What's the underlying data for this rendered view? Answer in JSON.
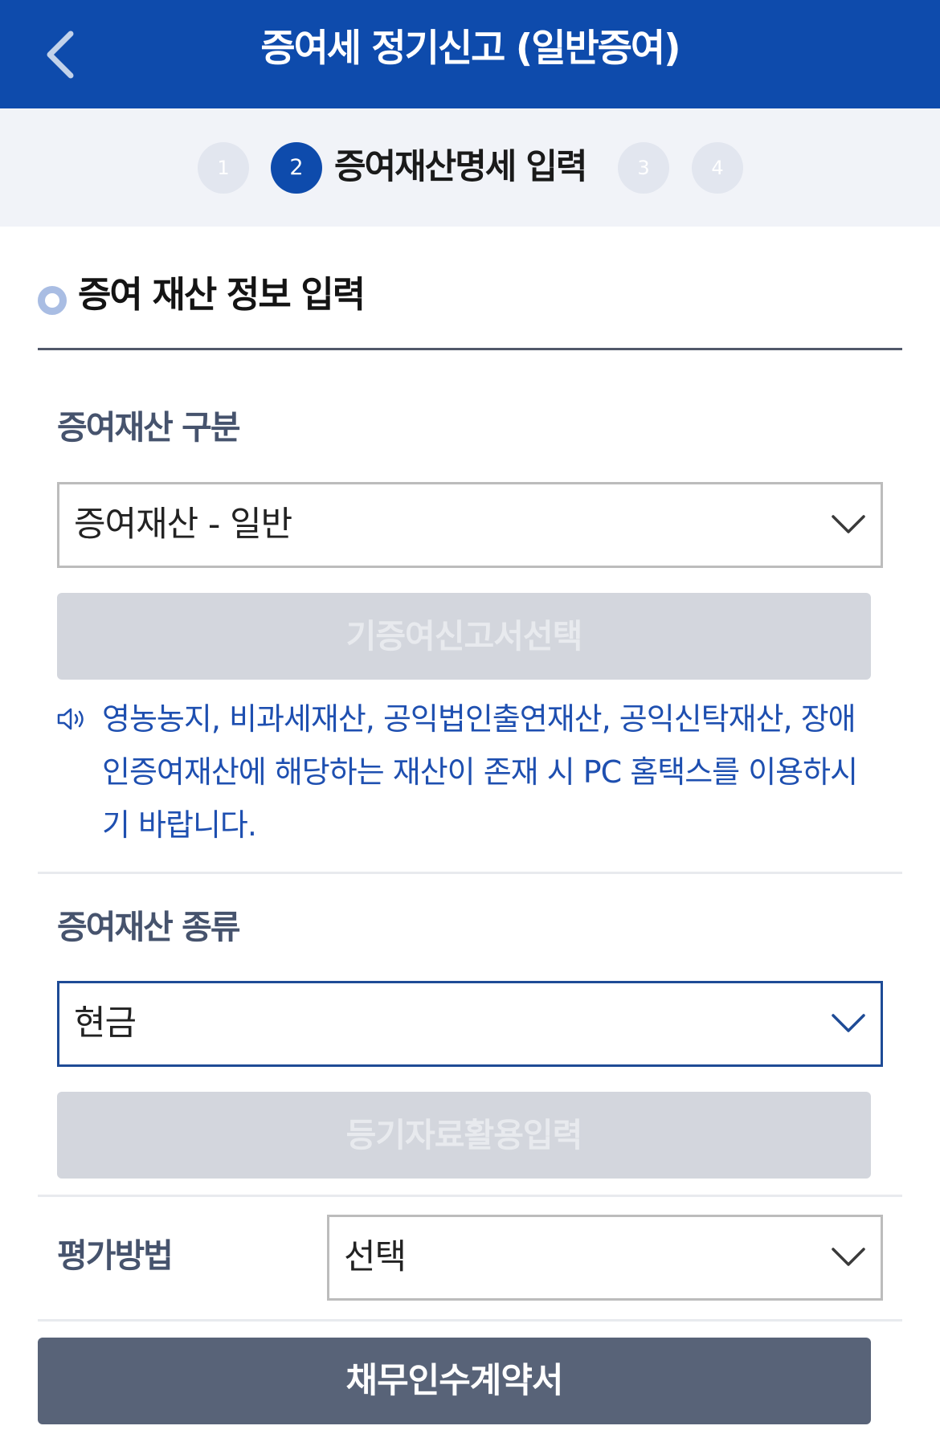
{
  "header": {
    "title": "증여세 정기신고 (일반증여)",
    "back_icon": "chevron-left-icon"
  },
  "steps": {
    "items": [
      "1",
      "2",
      "3",
      "4"
    ],
    "active_index": 1,
    "active_label": "증여재산명세 입력"
  },
  "section": {
    "title": "증여 재산 정보 입력"
  },
  "gift_category": {
    "label": "증여재산 구분",
    "selected": "증여재산 - 일반",
    "button_label": "기증여신고서선택"
  },
  "notice": {
    "icon": "speaker-icon",
    "text": "영농농지, 비과세재산, 공익법인출연재산, 공익신탁재산, 장애인증여재산에 해당하는 재산이 존재 시 PC 홈택스를 이용하시기 바랍니다."
  },
  "gift_type": {
    "label": "증여재산 종류",
    "selected": "현금",
    "button_label": "등기자료활용입력"
  },
  "valuation": {
    "label": "평가방법",
    "selected": "선택"
  },
  "debt_button_label": "채무인수계약서",
  "colors": {
    "header": "#0e4bac",
    "notice_text": "#1e4fb0",
    "primary_button": "#586378",
    "disabled_button": "#d3d6dd"
  }
}
